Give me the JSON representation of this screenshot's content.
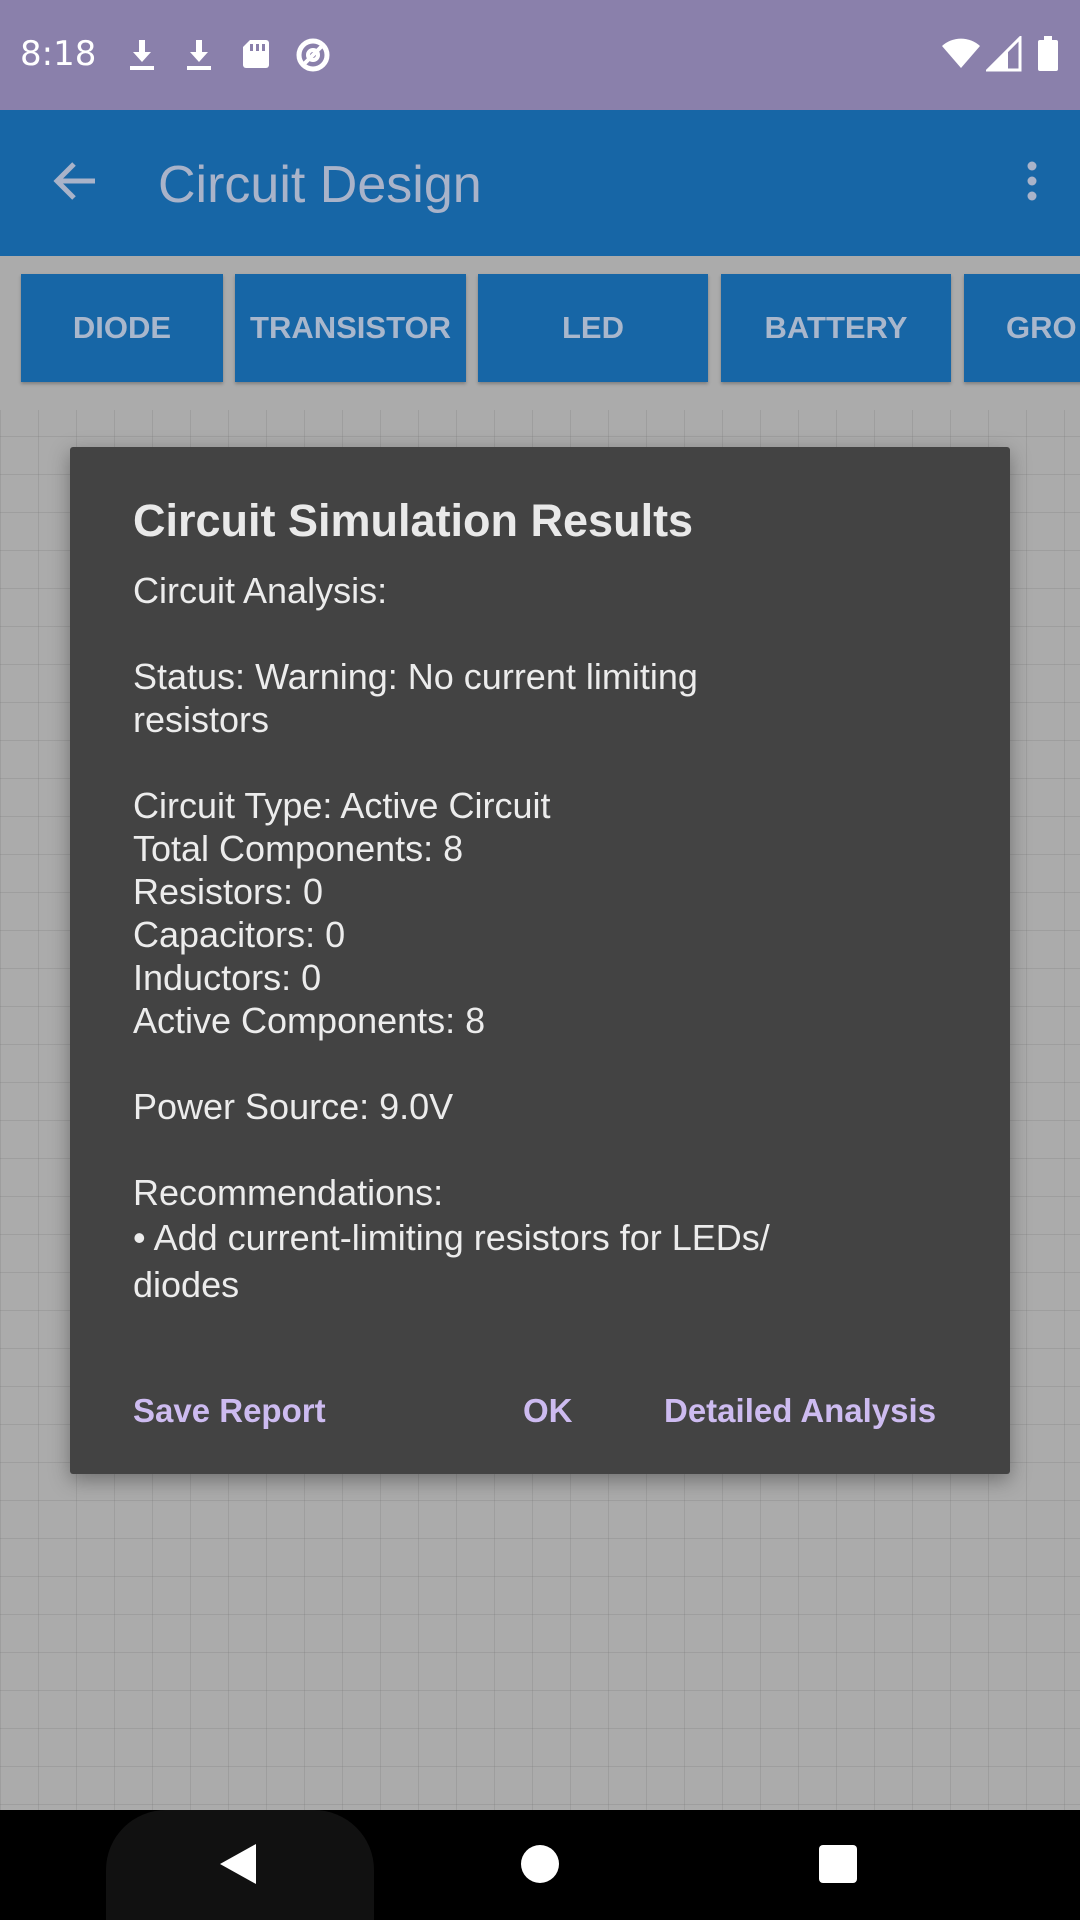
{
  "status_bar": {
    "time": "8:18",
    "left_icons": [
      "download-icon",
      "download-icon",
      "sd-card-icon",
      "data-saver-icon"
    ],
    "right_icons": [
      "wifi-icon",
      "signal-icon",
      "battery-icon"
    ]
  },
  "app_bar": {
    "title": "Circuit Design",
    "back_icon": "arrow-back-icon",
    "menu_icon": "more-vert-icon"
  },
  "components": [
    "DIODE",
    "TRANSISTOR",
    "LED",
    "BATTERY",
    "GRO"
  ],
  "dialog": {
    "title": "Circuit Simulation Results",
    "analysis_heading": "Circuit Analysis:",
    "status_line_1": "Status: Warning: No current limiting",
    "status_line_2": "resistors",
    "circuit_type": "Circuit Type: Active Circuit",
    "total_components": "Total Components: 8",
    "resistors": "Resistors: 0",
    "capacitors": "Capacitors: 0",
    "inductors": "Inductors: 0",
    "active_components": "Active Components: 8",
    "power_source": "Power Source: 9.0V",
    "recommendations_heading": "Recommendations:",
    "recommendation_line_1": "• Add current-limiting resistors for LEDs/",
    "recommendation_line_2": "diodes",
    "actions": {
      "save_report": "Save Report",
      "ok": "OK",
      "detailed_analysis": "Detailed Analysis"
    }
  },
  "colors": {
    "status_bar": "#8a80ab",
    "app_bar": "#1766a6",
    "dialog_bg": "#434343",
    "action_text": "#cdbbf0",
    "canvas_bg": "#ababab"
  }
}
